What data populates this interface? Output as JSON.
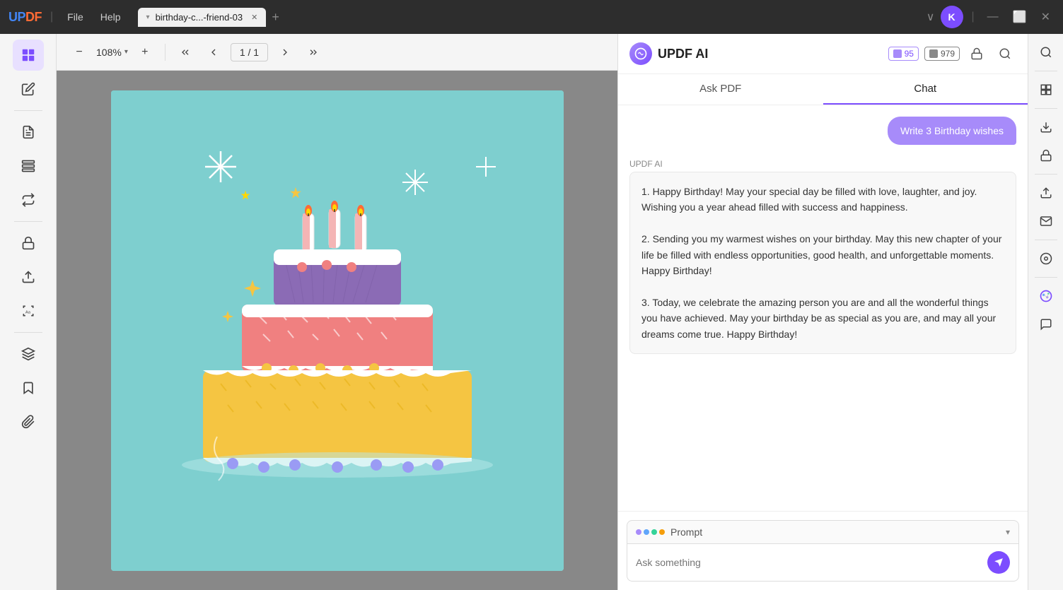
{
  "titlebar": {
    "logo_up": "UP",
    "logo_df": "DF",
    "divider": "|",
    "menu_file": "File",
    "menu_help": "Help",
    "tab_dropdown": "▾",
    "tab_name": "birthday-c...-friend-03",
    "tab_close": "✕",
    "tab_add": "+",
    "user_initial": "K",
    "win_minimize": "—",
    "win_maximize": "⬜",
    "win_close": "✕"
  },
  "toolbar": {
    "zoom_out": "−",
    "zoom_value": "108%",
    "zoom_dropdown": "▾",
    "zoom_in": "+",
    "page_first": "⟨⟨",
    "page_prev": "⟨",
    "page_display": "1 / 1",
    "page_next": "⟩",
    "page_last": "⟩⟩"
  },
  "sidebar_left": {
    "icons": [
      {
        "name": "view-icon",
        "symbol": "⊞",
        "active": true
      },
      {
        "name": "edit-icon",
        "symbol": "✏"
      },
      {
        "name": "annotate-icon",
        "symbol": "📝"
      },
      {
        "name": "organize-icon",
        "symbol": "☰"
      },
      {
        "name": "convert-icon",
        "symbol": "⇄"
      },
      {
        "name": "protect-icon",
        "symbol": "🔒"
      },
      {
        "name": "export-icon",
        "symbol": "↑"
      },
      {
        "name": "ocr-icon",
        "symbol": "Aa"
      },
      {
        "name": "layers-icon",
        "symbol": "◫"
      },
      {
        "name": "bookmark-icon",
        "symbol": "🔖"
      },
      {
        "name": "attachment-icon",
        "symbol": "📎"
      }
    ]
  },
  "ai_panel": {
    "title": "UPDF AI",
    "tokens_purple": "95",
    "tokens_gray": "979",
    "token_purple_prefix": "🟣",
    "token_gray_prefix": "📋",
    "tab_ask_pdf": "Ask PDF",
    "tab_chat": "Chat",
    "active_tab": "chat",
    "user_message": "Write 3 Birthday wishes",
    "ai_label": "UPDF AI",
    "response_text": "1. Happy Birthday! May your special day be filled with love, laughter, and joy. Wishing you a year ahead filled with success and happiness.\n\n2. Sending you my warmest wishes on your birthday. May this new chapter of your life be filled with endless opportunities, good health, and unforgettable moments. Happy Birthday!\n\n3. Today, we celebrate the amazing person you are and all the wonderful things you have achieved. May your birthday be as special as you are, and may all your dreams come true. Happy Birthday!",
    "prompt_label": "Prompt",
    "input_placeholder": "Ask something",
    "send_btn": "➤"
  },
  "sidebar_right": {
    "icons": [
      {
        "name": "search-right-icon",
        "symbol": "🔍"
      },
      {
        "name": "ocr-right-icon",
        "symbol": "⊞"
      },
      {
        "name": "scan-right-icon",
        "symbol": "⤓"
      },
      {
        "name": "protect-right-icon",
        "symbol": "🔒"
      },
      {
        "name": "share-right-icon",
        "symbol": "↑"
      },
      {
        "name": "email-right-icon",
        "symbol": "✉"
      },
      {
        "name": "snapshot-right-icon",
        "symbol": "⊙"
      },
      {
        "name": "ai-color-icon",
        "symbol": "✿"
      },
      {
        "name": "chat-right-icon",
        "symbol": "💬"
      }
    ]
  }
}
